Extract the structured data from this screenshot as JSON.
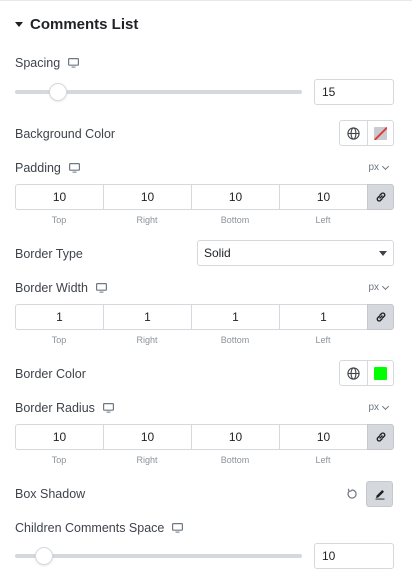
{
  "section": {
    "title": "Comments List"
  },
  "spacing": {
    "label": "Spacing",
    "value": "15",
    "slider_fraction": 0.15
  },
  "background_color": {
    "label": "Background Color",
    "color": "none"
  },
  "padding": {
    "label": "Padding",
    "unit": "px",
    "values": {
      "top": "10",
      "right": "10",
      "bottom": "10",
      "left": "10"
    },
    "labels": {
      "top": "Top",
      "right": "Right",
      "bottom": "Bottom",
      "left": "Left"
    }
  },
  "border_type": {
    "label": "Border Type",
    "value": "Solid"
  },
  "border_width": {
    "label": "Border Width",
    "unit": "px",
    "values": {
      "top": "1",
      "right": "1",
      "bottom": "1",
      "left": "1"
    },
    "labels": {
      "top": "Top",
      "right": "Right",
      "bottom": "Bottom",
      "left": "Left"
    }
  },
  "border_color": {
    "label": "Border Color",
    "color": "#00ff00"
  },
  "border_radius": {
    "label": "Border Radius",
    "unit": "px",
    "values": {
      "top": "10",
      "right": "10",
      "bottom": "10",
      "left": "10"
    },
    "labels": {
      "top": "Top",
      "right": "Right",
      "bottom": "Bottom",
      "left": "Left"
    }
  },
  "box_shadow": {
    "label": "Box Shadow"
  },
  "children_space": {
    "label": "Children Comments Space",
    "value": "10",
    "slider_fraction": 0.1
  },
  "icons": {
    "responsive": "monitor-icon",
    "global": "globe-icon",
    "link": "link-icon",
    "reset": "reset-icon",
    "edit": "pencil-icon"
  }
}
